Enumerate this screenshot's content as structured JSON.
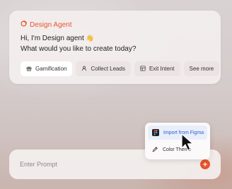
{
  "agent": {
    "brand": "Design Agent",
    "greeting_line1": "Hi, I'm Design agent",
    "wave_emoji": "👋",
    "greeting_line2": "What would you like to create today?"
  },
  "chips": [
    {
      "label": "Gamification",
      "icon": "gift-icon"
    },
    {
      "label": "Collect Leads",
      "icon": "user-icon"
    },
    {
      "label": "Exit Intent",
      "icon": "exit-icon"
    },
    {
      "label": "See more",
      "icon": ""
    }
  ],
  "prompt": {
    "placeholder": "Enter Prompt"
  },
  "popup": {
    "items": [
      {
        "label": "Import from Figma",
        "icon": "figma-icon",
        "active": true
      },
      {
        "label": "Color Theme",
        "icon": "eyedropper-icon",
        "active": false
      }
    ]
  },
  "colors": {
    "accent": "#e8542c",
    "active_item_text": "#2f5fd0",
    "active_item_bg": "#e9eefb"
  }
}
